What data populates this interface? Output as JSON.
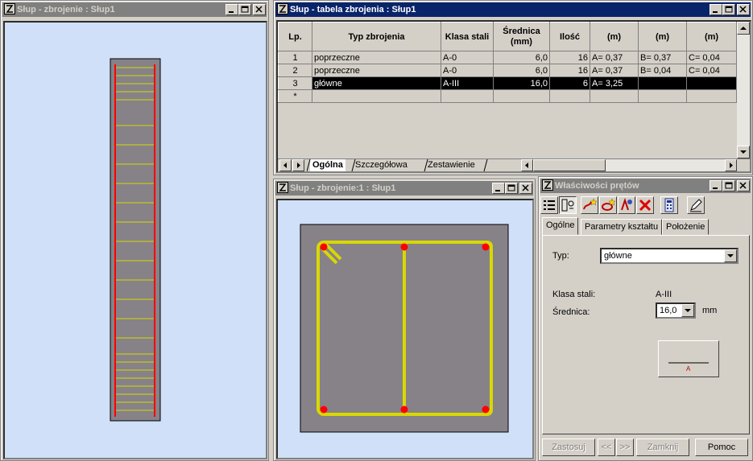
{
  "windows": {
    "elevation": {
      "title": "Słup - zbrojenie : Słup1"
    },
    "table": {
      "title": "Słup - tabela zbrojenia : Słup1"
    },
    "section": {
      "title": "Słup - zbrojenie:1 : Słup1"
    },
    "props": {
      "title": "Właściwości prętów"
    }
  },
  "table": {
    "headers": [
      "Lp.",
      "Typ zbrojenia",
      "Klasa stali",
      "Średnica\n(mm)",
      "Ilość",
      "(m)",
      "(m)",
      "(m)"
    ],
    "rows": [
      {
        "lp": "1",
        "typ": "poprzeczne",
        "klasa": "A-0",
        "srednica": "6,0",
        "ilosc": "16",
        "a": "A= 0,37",
        "b": "B= 0,37",
        "c": "C= 0,04"
      },
      {
        "lp": "2",
        "typ": "poprzeczne",
        "klasa": "A-0",
        "srednica": "6,0",
        "ilosc": "16",
        "a": "A= 0,37",
        "b": "B= 0,04",
        "c": "C= 0,04"
      },
      {
        "lp": "3",
        "typ": "główne",
        "klasa": "A-III",
        "srednica": "16,0",
        "ilosc": "6",
        "a": "A= 3,25",
        "b": "",
        "c": ""
      },
      {
        "lp": "*",
        "typ": "",
        "klasa": "",
        "srednica": "",
        "ilosc": "",
        "a": "",
        "b": "",
        "c": ""
      }
    ],
    "bottom_tabs": [
      "Ogólna",
      "Szczegółowa",
      "Zestawienie"
    ]
  },
  "props": {
    "tabs": [
      "Ogólne",
      "Parametry kształtu",
      "Położenie"
    ],
    "typ_label": "Typ:",
    "typ_value": "główne",
    "klasa_label": "Klasa stali:",
    "klasa_value": "A-III",
    "srednica_label": "Średnica:",
    "srednica_value": "16,0",
    "srednica_unit": "mm",
    "shape_letter": "A",
    "buttons": {
      "apply": "Zastosuj",
      "prev": "<<",
      "next": ">>",
      "close": "Zamknij",
      "help": "Pomoc"
    }
  },
  "colors": {
    "viewport_bg": "#cfe0f8",
    "concrete": "#868288",
    "rebar_main": "#ff0000",
    "stirrup": "#d8d800",
    "active_title": "#0a246a"
  }
}
